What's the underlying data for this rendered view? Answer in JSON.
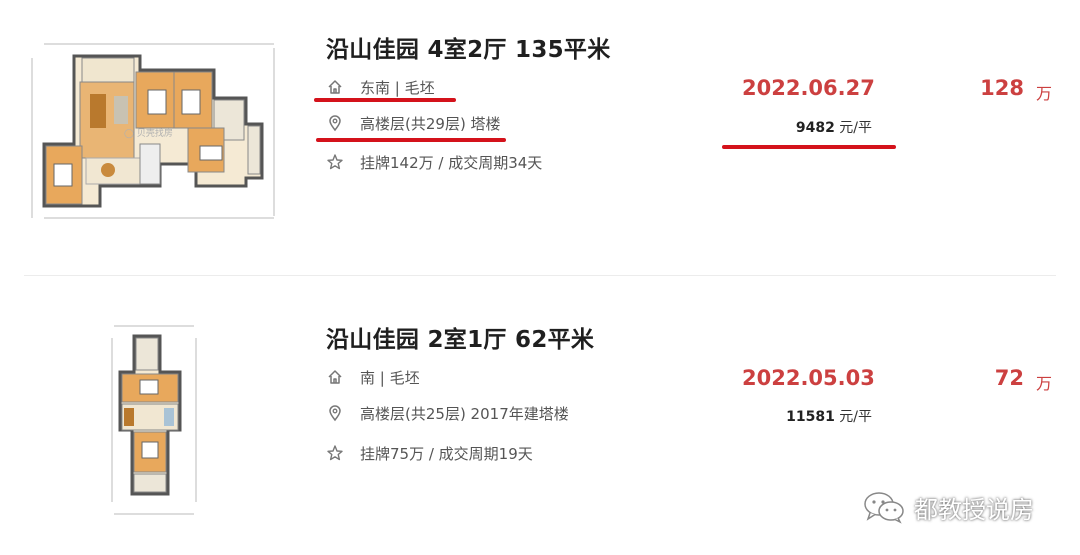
{
  "listings": [
    {
      "title": "沿山佳园 4室2厅 135平米",
      "orientation": "东南 | 毛坯",
      "floor": "高楼层(共29层) 塔楼",
      "deal": "挂牌142万 / 成交周期34天",
      "date": "2022.06.27",
      "price": "128",
      "price_unit": "万",
      "unit_price_value": "9482",
      "unit_price_unit": "元/平",
      "thumbnail_icon": "floorplan-image"
    },
    {
      "title": "沿山佳园 2室1厅 62平米",
      "orientation": "南 | 毛坯",
      "floor": "高楼层(共25层) 2017年建塔楼",
      "deal": "挂牌75万 / 成交周期19天",
      "date": "2022.05.03",
      "price": "72",
      "price_unit": "万",
      "unit_price_value": "11581",
      "unit_price_unit": "元/平",
      "thumbnail_icon": "floorplan-image"
    }
  ],
  "icons": {
    "orientation": "house-icon",
    "floor": "location-pin-icon",
    "deal": "star-icon"
  },
  "annotation_color": "#d4121b",
  "accent_color": "#cc4040",
  "watermark": {
    "text": "都教授说房",
    "icon": "wechat-icon"
  }
}
